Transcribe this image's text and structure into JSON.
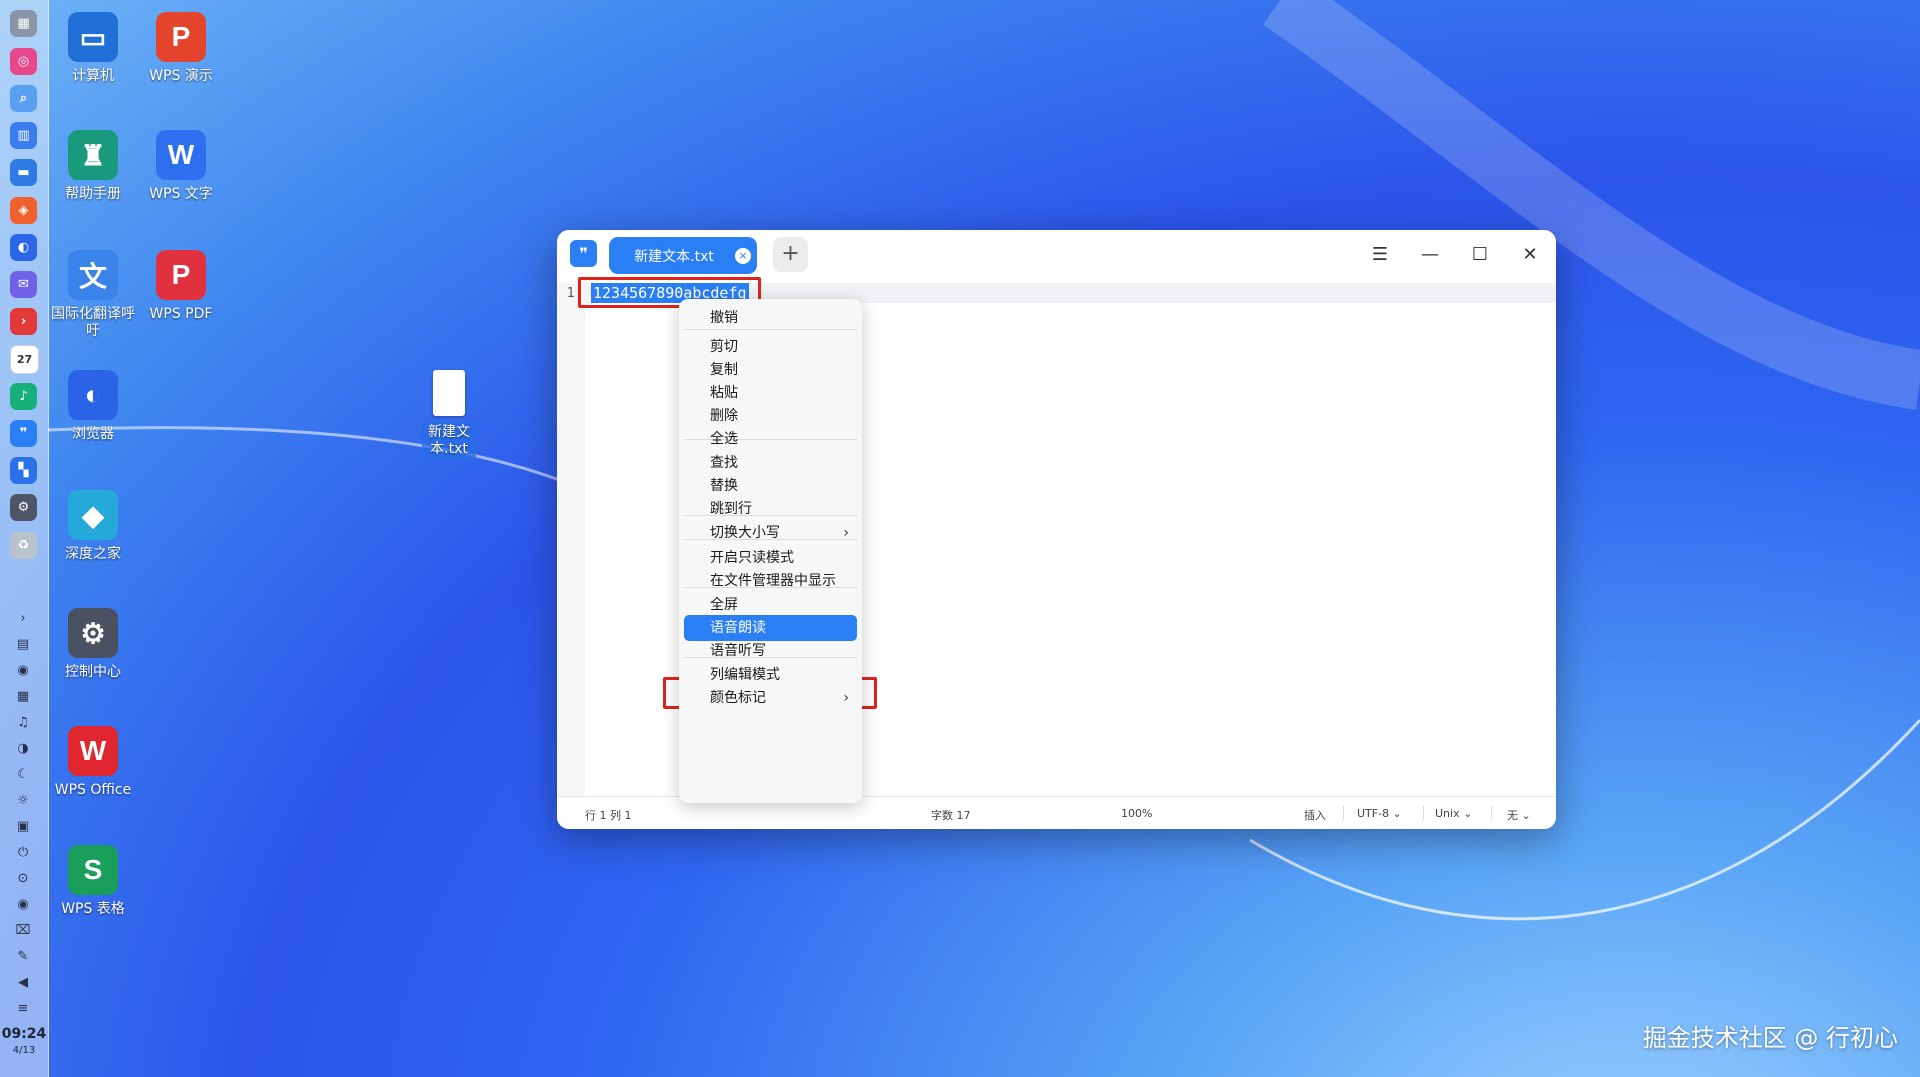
{
  "dock": {
    "apps": [
      {
        "icon": "launcher-icon",
        "color": "#8a95a8",
        "glyph": "▦"
      },
      {
        "icon": "app-store-icon",
        "color": "#e8478a",
        "glyph": "◎"
      },
      {
        "icon": "search-icon",
        "color": "#5aa0f0",
        "glyph": "⌕"
      },
      {
        "icon": "multitask-icon",
        "color": "#3b7df0",
        "glyph": "▥"
      },
      {
        "icon": "file-manager-icon",
        "color": "#2f7be6",
        "glyph": "▬"
      },
      {
        "icon": "store-icon",
        "color": "#f0612e",
        "glyph": "◈"
      },
      {
        "icon": "browser-icon",
        "color": "#2c66e8",
        "glyph": "◐"
      },
      {
        "icon": "mail-icon",
        "color": "#6f62e6",
        "glyph": "✉"
      },
      {
        "icon": "terminal-icon",
        "color": "#e23a3a",
        "glyph": "›"
      },
      {
        "icon": "calendar-icon",
        "color": "#ffffff",
        "glyph": "27"
      },
      {
        "icon": "music-icon",
        "color": "#16b07a",
        "glyph": "♪"
      },
      {
        "icon": "text-editor-icon",
        "color": "#2a7ff5",
        "glyph": "❞"
      },
      {
        "icon": "app-grid-icon",
        "color": "#2b72e8",
        "glyph": "▚"
      },
      {
        "icon": "settings-icon",
        "color": "#4d5566",
        "glyph": "⚙"
      },
      {
        "icon": "trash-icon",
        "color": "#b8c2cc",
        "glyph": "♻"
      }
    ],
    "tray": [
      {
        "icon": "expand-tray-icon",
        "glyph": "›"
      },
      {
        "icon": "clipboard-icon",
        "glyph": "▤"
      },
      {
        "icon": "assistant-icon",
        "glyph": "◉"
      },
      {
        "icon": "keyboard-icon",
        "glyph": "▦"
      },
      {
        "icon": "notification-icon",
        "glyph": "♫"
      },
      {
        "icon": "theme-icon",
        "glyph": "◑"
      },
      {
        "icon": "night-mode-icon",
        "glyph": "☾"
      },
      {
        "icon": "brightness-icon",
        "glyph": "☼"
      },
      {
        "icon": "calculator-icon",
        "glyph": "▣"
      },
      {
        "icon": "power-icon",
        "glyph": "⏻"
      },
      {
        "icon": "download-icon",
        "glyph": "⊙"
      },
      {
        "icon": "record-icon",
        "glyph": "◉"
      },
      {
        "icon": "screenshot-icon",
        "glyph": "⌧"
      },
      {
        "icon": "pen-icon",
        "glyph": "✎"
      },
      {
        "icon": "volume-icon",
        "glyph": "◀"
      },
      {
        "icon": "storage-icon",
        "glyph": "≡"
      }
    ],
    "time": "09:24",
    "date": "4/13"
  },
  "desktop": {
    "icons": [
      {
        "label": "计算机",
        "glyph": "▭",
        "color": "#1f6fd6"
      },
      {
        "label": "WPS 演示",
        "glyph": "P",
        "color": "#e5442c"
      },
      {
        "label": "帮助手册",
        "glyph": "♜",
        "color": "#1a9a7c"
      },
      {
        "label": "WPS 文字",
        "glyph": "W",
        "color": "#2e6ff0"
      },
      {
        "label": "国际化翻译呼吁",
        "glyph": "文",
        "color": "#3a83e8"
      },
      {
        "label": "WPS PDF",
        "glyph": "P",
        "color": "#e0323e"
      },
      {
        "label": "浏览器",
        "glyph": "◐",
        "color": "#2a63e6"
      },
      {
        "label": "新建文本.txt",
        "glyph": "",
        "color": "#ffffff"
      },
      {
        "label": "深度之家",
        "glyph": "◆",
        "color": "#25a9d8"
      },
      {
        "label": "控制中心",
        "glyph": "⚙",
        "color": "#4a5160"
      },
      {
        "label": "WPS Office",
        "glyph": "W",
        "color": "#e0262e"
      },
      {
        "label": "WPS 表格",
        "glyph": "S",
        "color": "#1a9e5c"
      }
    ]
  },
  "editor": {
    "tab_title": "新建文本.txt",
    "tab_close": "×",
    "tab_add": "+",
    "menu_btn": "☰",
    "minimize_btn": "—",
    "maximize_btn": "☐",
    "close_btn": "✕",
    "line_number": "1",
    "selected_text": "1234567890abcdefg",
    "status": {
      "position": "行 1 列 1",
      "char_count": "字数 17",
      "zoom": "100%",
      "insert_mode": "插入",
      "encoding": "UTF-8 ⌄",
      "line_ending": "Unix ⌄",
      "highlight": "无 ⌄"
    }
  },
  "context_menu": {
    "items": [
      {
        "label": "撤销"
      },
      {
        "label": "剪切"
      },
      {
        "label": "复制"
      },
      {
        "label": "粘贴"
      },
      {
        "label": "删除"
      },
      {
        "label": "全选"
      },
      {
        "label": "查找"
      },
      {
        "label": "替换"
      },
      {
        "label": "跳到行"
      },
      {
        "label": "切换大小写",
        "arrow": "›"
      },
      {
        "label": "开启只读模式"
      },
      {
        "label": "在文件管理器中显示"
      },
      {
        "label": "全屏"
      },
      {
        "label": "语音朗读"
      },
      {
        "label": "语音听写"
      },
      {
        "label": "列编辑模式"
      },
      {
        "label": "颜色标记",
        "arrow": "›"
      }
    ]
  },
  "watermark": "掘金技术社区 @ 行初心"
}
